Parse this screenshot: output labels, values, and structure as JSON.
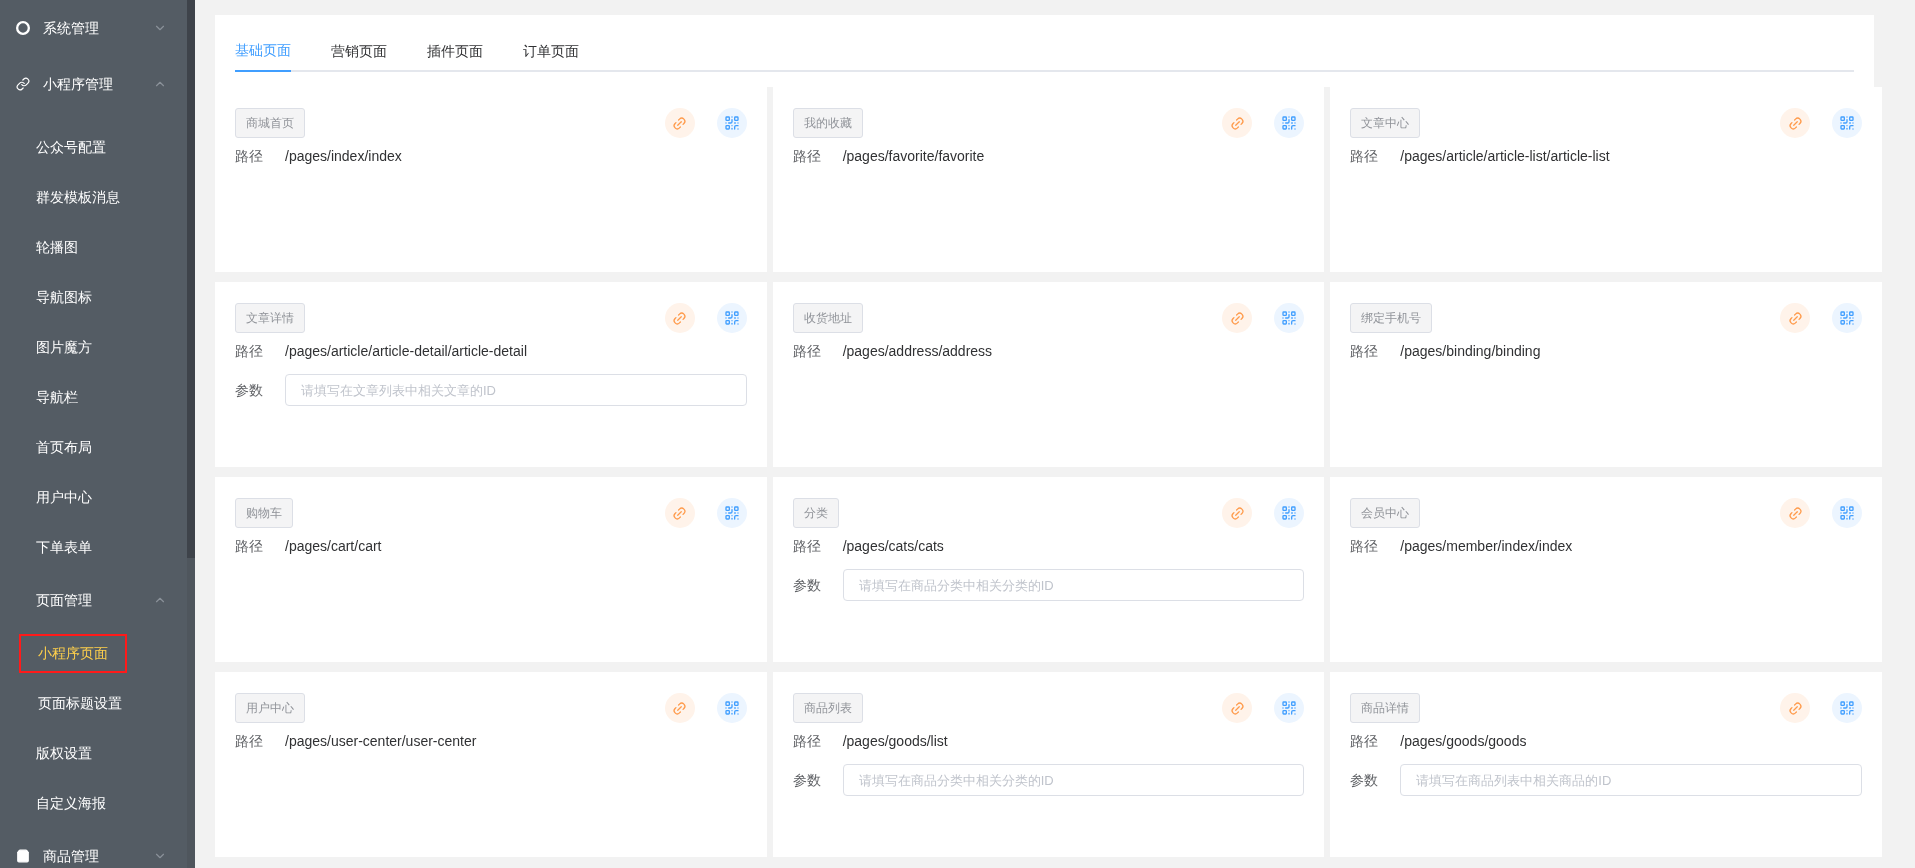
{
  "sidebar": {
    "items": [
      {
        "label": "系统管理",
        "kind": "gear",
        "expanded": false
      },
      {
        "label": "小程序管理",
        "kind": "link",
        "expanded": true,
        "children": [
          {
            "label": "公众号配置",
            "selected": false
          },
          {
            "label": "群发模板消息",
            "selected": false
          },
          {
            "label": "轮播图",
            "selected": false
          },
          {
            "label": "导航图标",
            "selected": false
          },
          {
            "label": "图片魔方",
            "selected": false
          },
          {
            "label": "导航栏",
            "selected": false
          },
          {
            "label": "首页布局",
            "selected": false
          },
          {
            "label": "用户中心",
            "selected": false
          },
          {
            "label": "下单表单",
            "selected": false
          },
          {
            "label": "页面管理",
            "expanded": true,
            "children": [
              {
                "label": "小程序页面",
                "selected": true
              },
              {
                "label": "页面标题设置",
                "selected": false
              }
            ]
          },
          {
            "label": "版权设置",
            "selected": false
          },
          {
            "label": "自定义海报",
            "selected": false
          }
        ]
      },
      {
        "label": "商品管理",
        "kind": "bag",
        "expanded": false
      }
    ]
  },
  "tabs": [
    {
      "label": "基础页面",
      "selected": true
    },
    {
      "label": "营销页面",
      "selected": false
    },
    {
      "label": "插件页面",
      "selected": false
    },
    {
      "label": "订单页面",
      "selected": false
    }
  ],
  "cards": [
    {
      "name": "商城首页",
      "path_label": "路径",
      "path": "/pages/index/index"
    },
    {
      "name": "我的收藏",
      "path_label": "路径",
      "path": "/pages/favorite/favorite"
    },
    {
      "name": "文章中心",
      "path_label": "路径",
      "path": "/pages/article/article-list/article-list"
    },
    {
      "name": "文章详情",
      "path_label": "路径",
      "path": "/pages/article/article-detail/article-detail",
      "param_label": "参数",
      "placeholder": "请填写在文章列表中相关文章的ID"
    },
    {
      "name": "收货地址",
      "path_label": "路径",
      "path": "/pages/address/address"
    },
    {
      "name": "绑定手机号",
      "path_label": "路径",
      "path": "/pages/binding/binding"
    },
    {
      "name": "购物车",
      "path_label": "路径",
      "path": "/pages/cart/cart"
    },
    {
      "name": "分类",
      "path_label": "路径",
      "path": "/pages/cats/cats",
      "param_label": "参数",
      "placeholder": "请填写在商品分类中相关分类的ID"
    },
    {
      "name": "会员中心",
      "path_label": "路径",
      "path": "/pages/member/index/index"
    },
    {
      "name": "用户中心",
      "path_label": "路径",
      "path": "/pages/user-center/user-center"
    },
    {
      "name": "商品列表",
      "path_label": "路径",
      "path": "/pages/goods/list",
      "param_label": "参数",
      "placeholder": "请填写在商品分类中相关分类的ID"
    },
    {
      "name": "商品详情",
      "path_label": "路径",
      "path": "/pages/goods/goods",
      "param_label": "参数",
      "placeholder": "请填写在商品列表中相关商品的ID"
    }
  ]
}
